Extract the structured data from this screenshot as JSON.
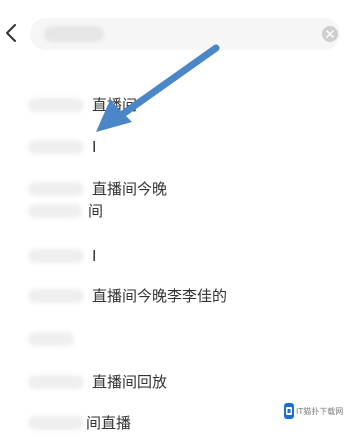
{
  "search": {
    "value": ""
  },
  "suggestions": [
    {
      "text": "直播间"
    },
    {
      "text": "I"
    },
    {
      "text": "直播间今晚"
    },
    {
      "text": "间"
    },
    {
      "text": "I"
    },
    {
      "text": "直播间今晚李李佳的"
    },
    {
      "text": ""
    },
    {
      "text": "直播间回放"
    },
    {
      "text": "间直播"
    }
  ],
  "annotation": {
    "arrow_color": "#4a86c8"
  },
  "watermark": {
    "text": "IT猫扑下载网",
    "logo_color": "#1b6fd6"
  }
}
